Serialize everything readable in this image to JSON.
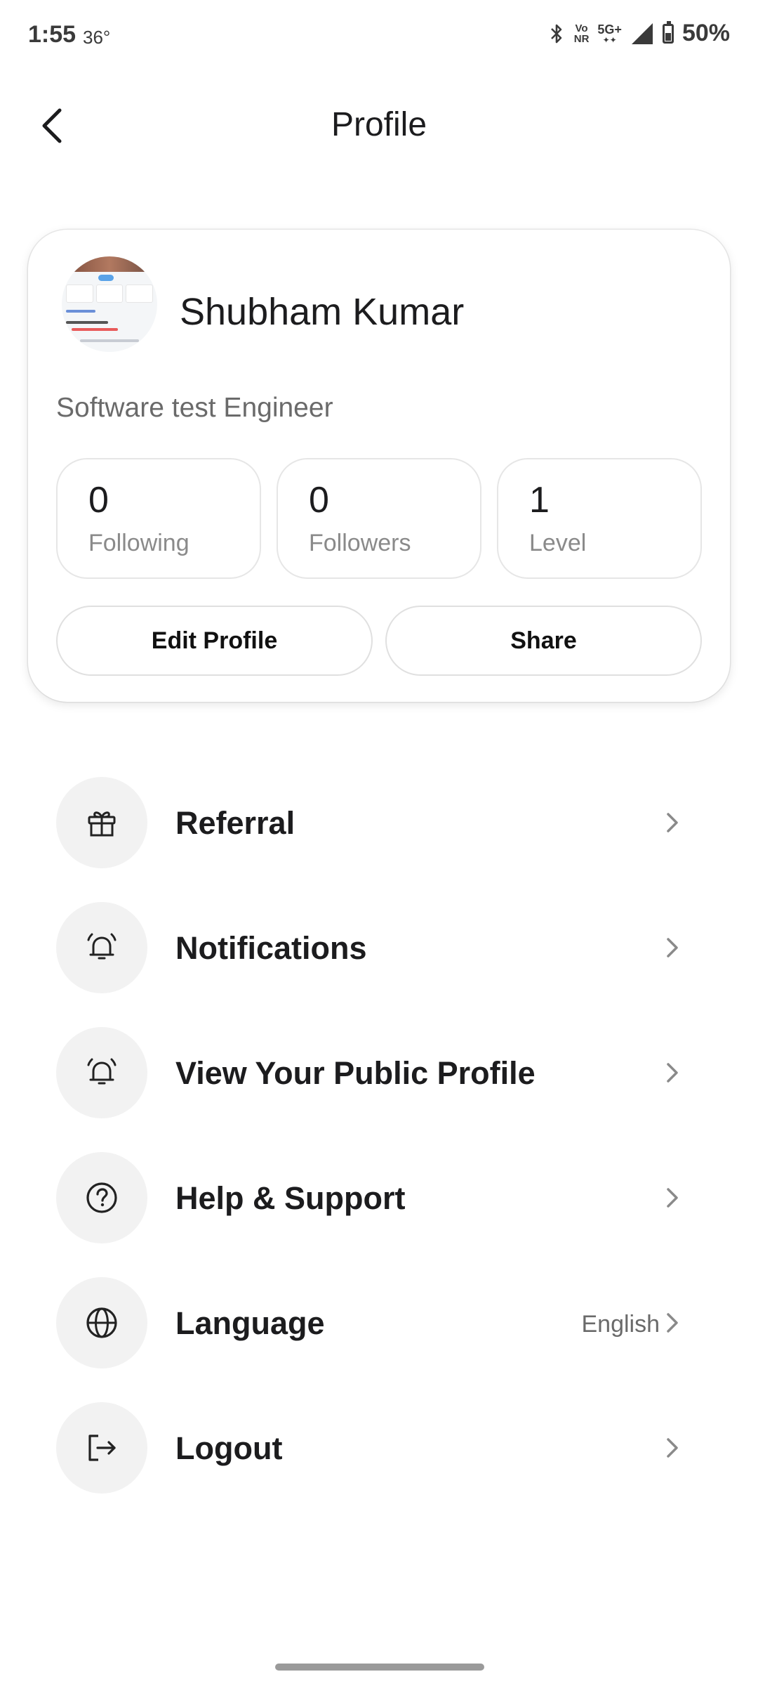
{
  "status_bar": {
    "time": "1:55",
    "temperature": "36°",
    "vonr_top": "Vo",
    "vonr_bottom": "NR",
    "network": "5G+",
    "battery": "50%"
  },
  "header": {
    "title": "Profile",
    "back_icon": "chevron-left-icon"
  },
  "profile": {
    "name": "Shubham Kumar",
    "role": "Software test Engineer",
    "stats": [
      {
        "value": "0",
        "label": "Following"
      },
      {
        "value": "0",
        "label": "Followers"
      },
      {
        "value": "1",
        "label": "Level"
      }
    ],
    "edit_label": "Edit Profile",
    "share_label": "Share"
  },
  "menu": [
    {
      "label": "Referral",
      "icon": "gift-icon",
      "value": ""
    },
    {
      "label": "Notifications",
      "icon": "bell-icon",
      "value": ""
    },
    {
      "label": "View Your Public Profile",
      "icon": "bell-icon",
      "value": ""
    },
    {
      "label": "Help & Support",
      "icon": "question-circle-icon",
      "value": ""
    },
    {
      "label": "Language",
      "icon": "globe-icon",
      "value": "English"
    },
    {
      "label": "Logout",
      "icon": "logout-icon",
      "value": ""
    }
  ],
  "colors": {
    "text_primary": "#1c1c1e",
    "text_secondary": "#6a6a6a",
    "icon_bg": "#f2f2f2",
    "border": "#e6e6e6"
  }
}
